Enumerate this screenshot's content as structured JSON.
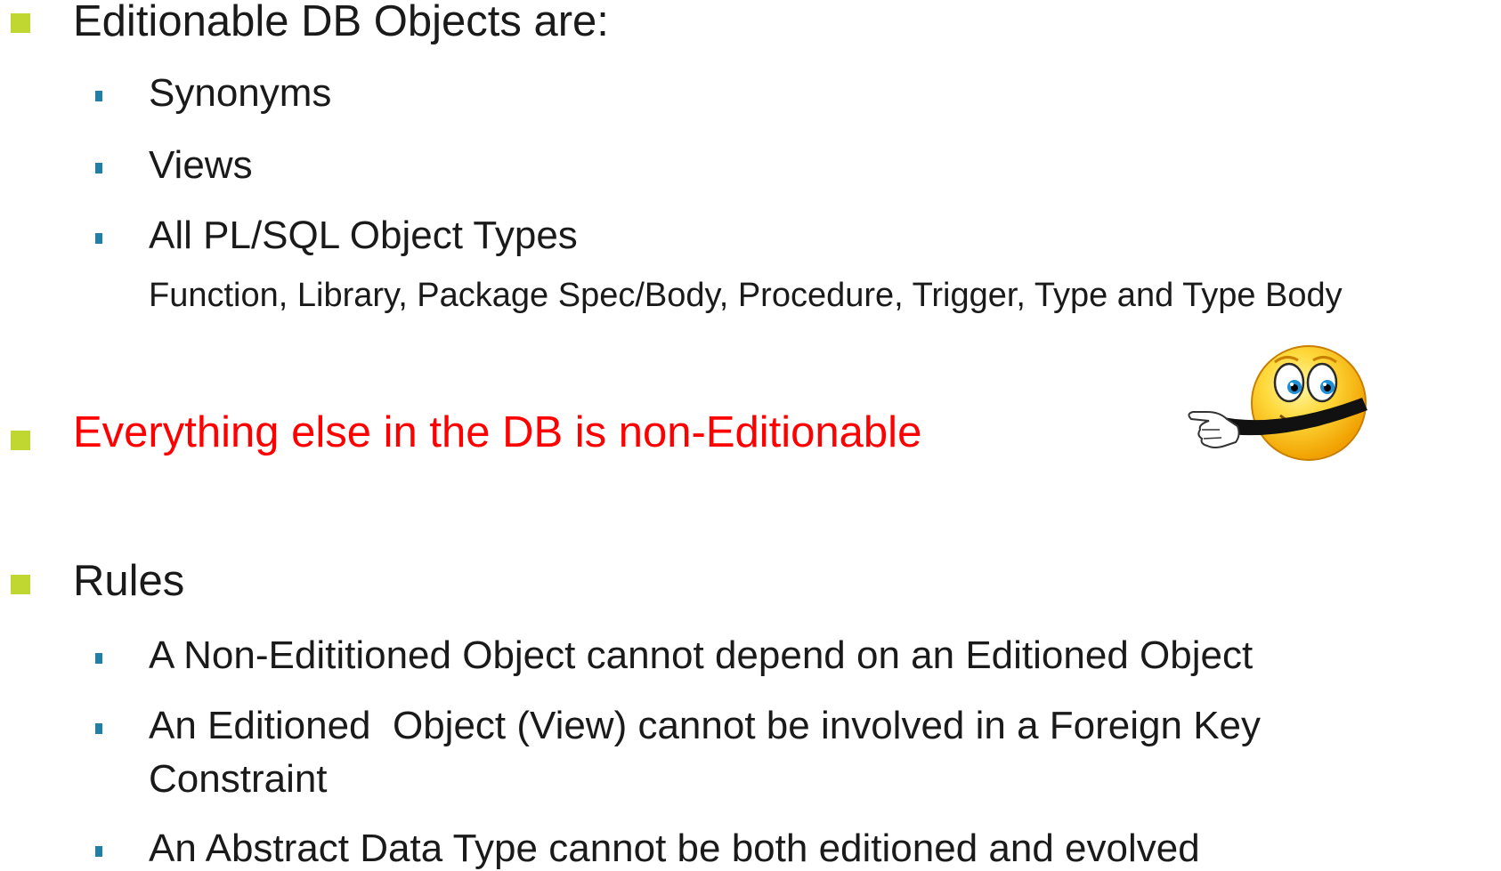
{
  "section1": {
    "heading": "Editionable DB Objects are:",
    "items": [
      {
        "label": "Synonyms"
      },
      {
        "label": "Views"
      },
      {
        "label": "All PL/SQL Object Types",
        "sub": "Function, Library, Package Spec/Body, Procedure, Trigger, Type and Type Body"
      }
    ]
  },
  "section2": {
    "heading": "Everything else in the DB is non-Editionable",
    "heading_color": "#ff0000"
  },
  "section3": {
    "heading": "Rules",
    "items": [
      {
        "line1": "A Non-Edititioned Object cannot depend on an Editioned Object"
      },
      {
        "line1": "An Editioned  Object (View) cannot be involved in a Foreign Key",
        "line2": "Constraint"
      },
      {
        "line1": "An Abstract Data Type cannot be both editioned and evolved"
      }
    ]
  },
  "colors": {
    "level1_bullet": "#bfd730",
    "level2_bullet": "#1f7fa6"
  },
  "icons": {
    "pointer": "pointing-smiley-icon"
  }
}
